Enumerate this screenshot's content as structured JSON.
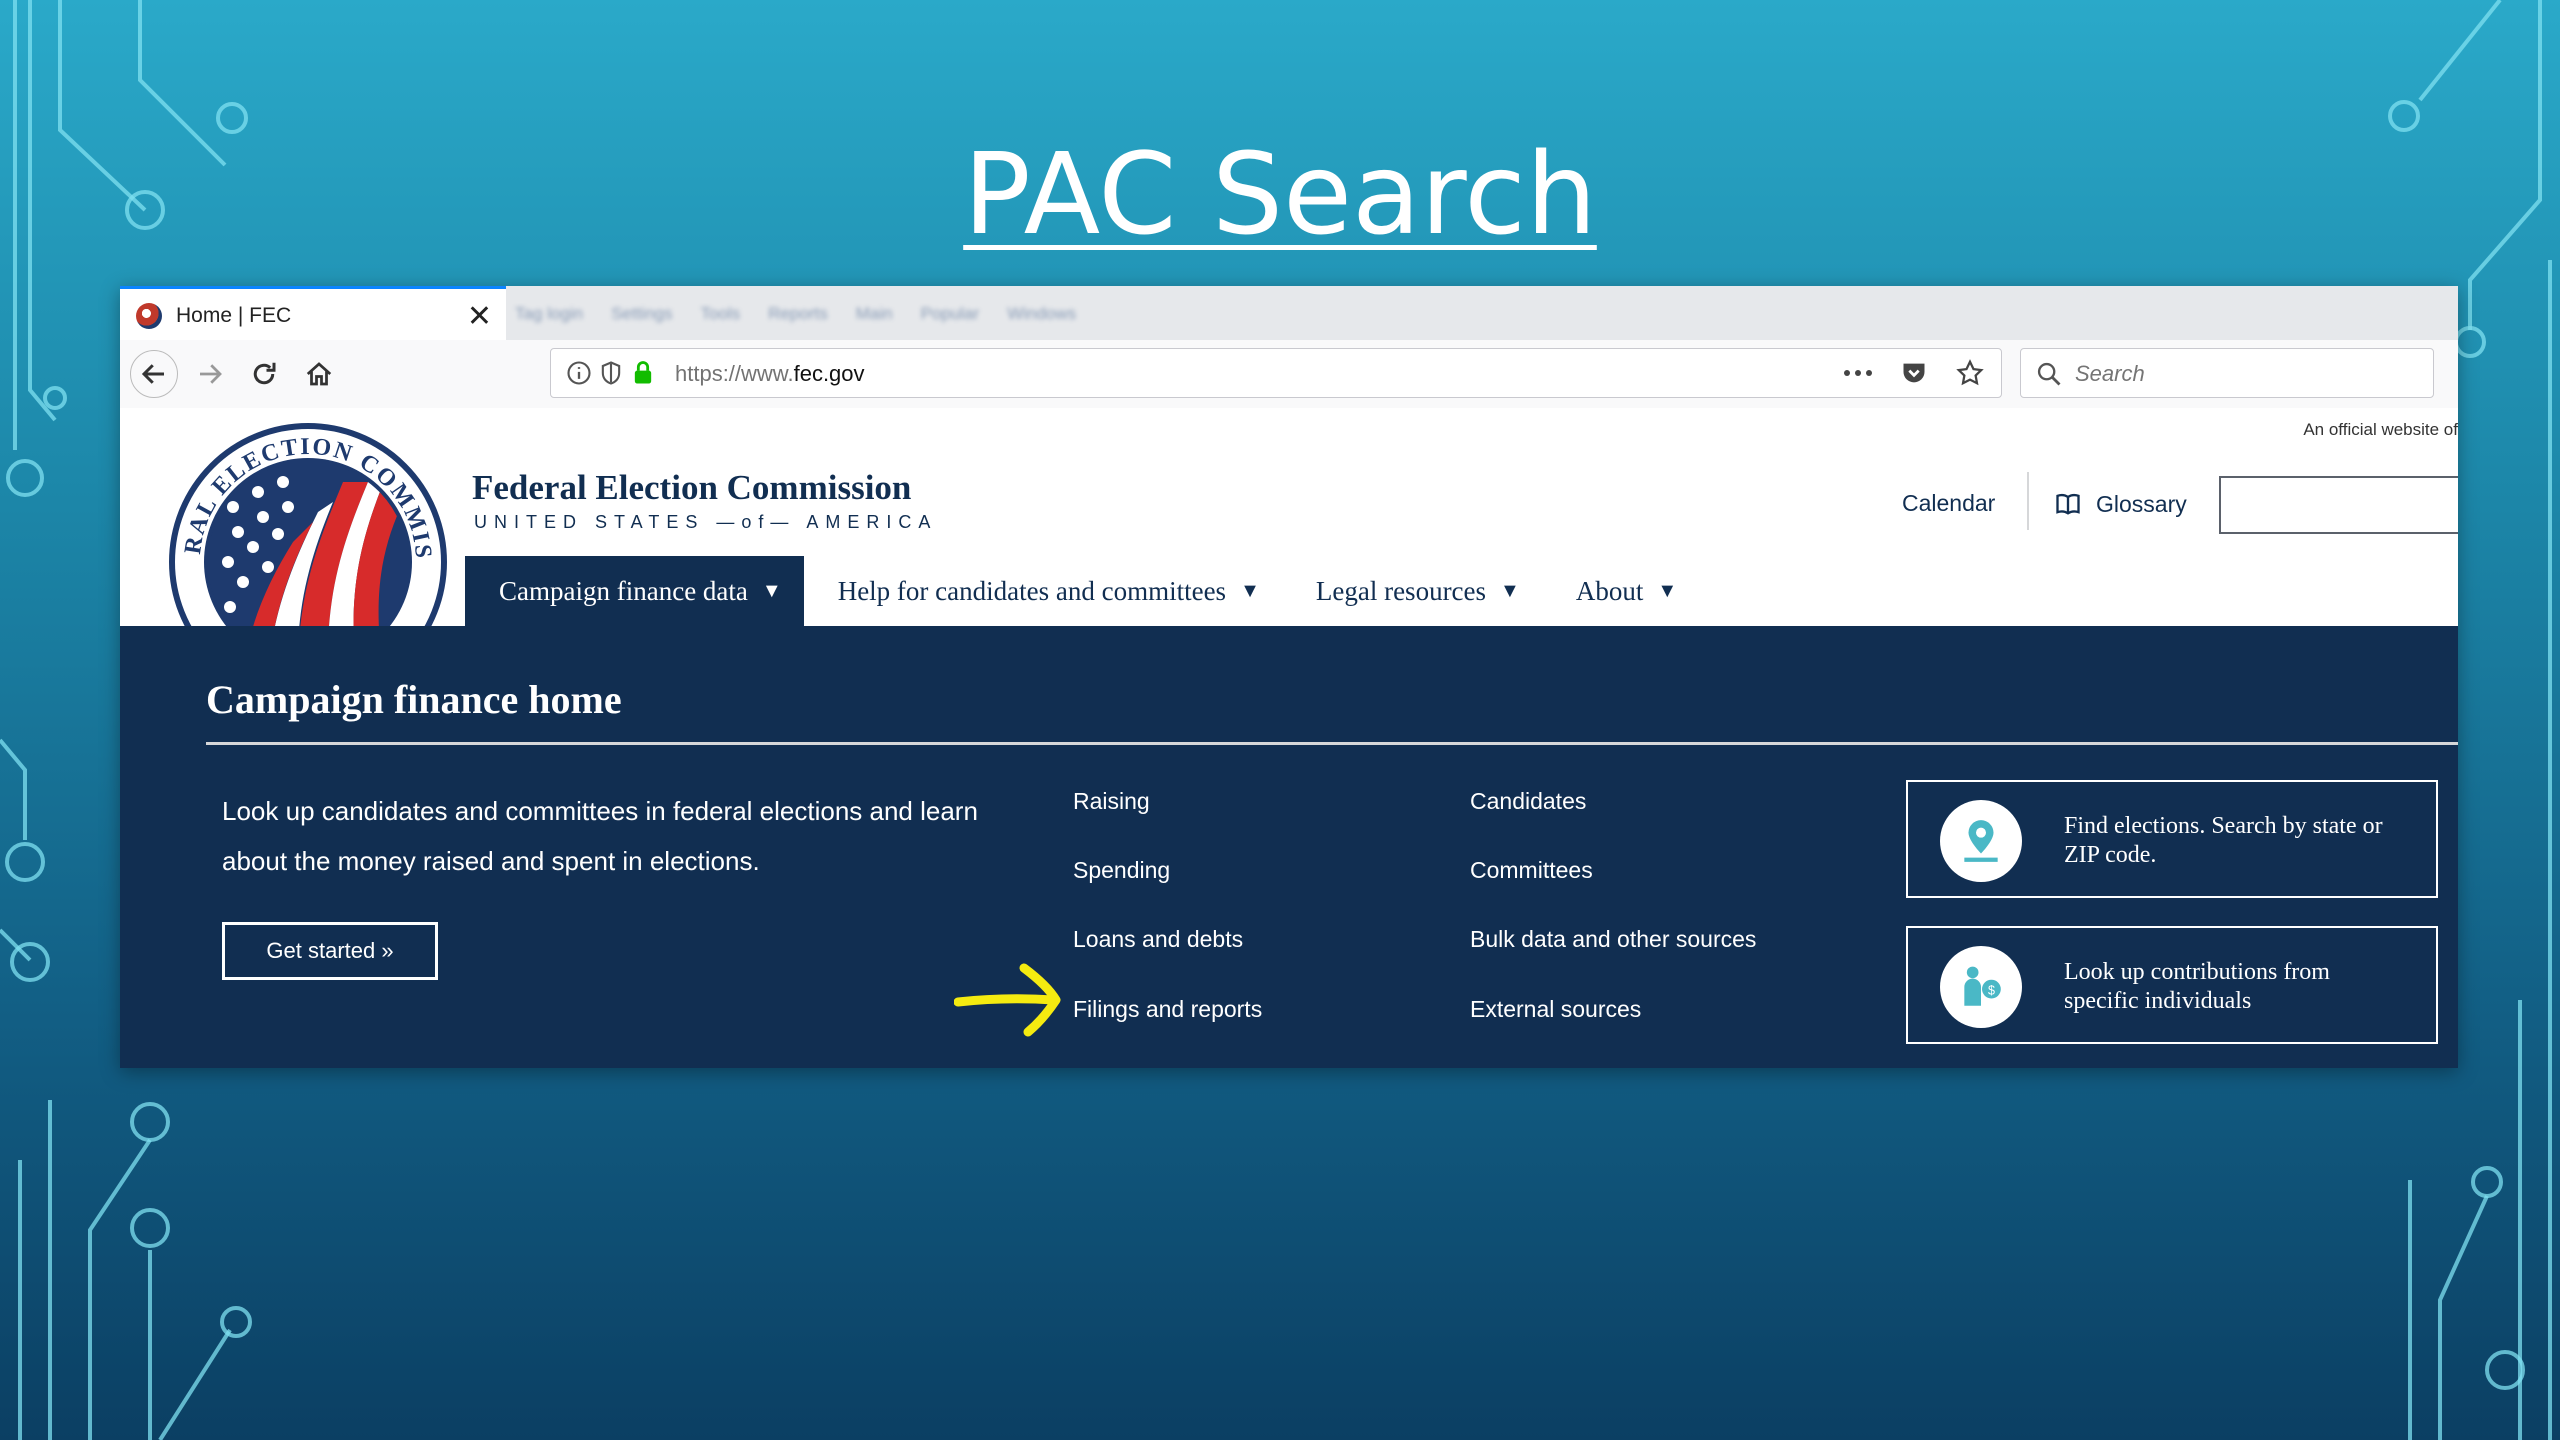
{
  "slide": {
    "title": "PAC Search"
  },
  "browser": {
    "tab": {
      "title": "Home | FEC",
      "close": "✕"
    },
    "other_tabs": [
      "Tag login",
      "Settings",
      "Tools",
      "Reports",
      "Main",
      "Popular",
      "Windows"
    ],
    "url": {
      "prefix": "https://www.",
      "domain": "fec.gov"
    },
    "search_placeholder": "Search"
  },
  "site": {
    "official_notice": "An official website of",
    "name": "Federal Election Commission",
    "subtitle": "UNITED STATES —of— AMERICA",
    "header_links": {
      "calendar": "Calendar",
      "glossary": "Glossary"
    },
    "nav": [
      {
        "label": "Campaign finance data"
      },
      {
        "label": "Help for candidates and committees"
      },
      {
        "label": "Legal resources"
      },
      {
        "label": "About"
      }
    ],
    "caret": "▼",
    "panel": {
      "title": "Campaign finance home",
      "description": "Look up candidates and committees in federal elections and learn about the money raised and spent in elections.",
      "cta": "Get started »",
      "col1": [
        "Raising",
        "Spending",
        "Loans and debts",
        "Filings and reports"
      ],
      "col2": [
        "Candidates",
        "Committees",
        "Bulk data and other sources",
        "External sources"
      ],
      "callouts": [
        {
          "text": "Find elections. Search by state or ZIP code."
        },
        {
          "text": "Look up contributions from specific individuals"
        }
      ]
    }
  },
  "colors": {
    "navy": "#112e51",
    "arrow": "#f5eb10",
    "accent": "#0a84ff",
    "teal": "#4ab8c6"
  }
}
